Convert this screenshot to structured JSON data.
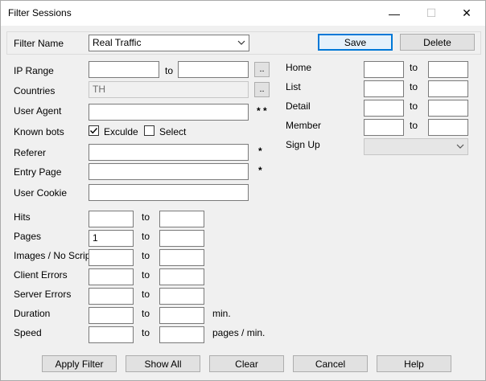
{
  "window": {
    "title": "Filter Sessions",
    "minimize_label": "—",
    "maximize_label": "☐",
    "close_label": "✕"
  },
  "filter": {
    "name_label": "Filter Name",
    "name_value": "Real Traffic",
    "save_label": "Save",
    "delete_label": "Delete"
  },
  "left": {
    "ip_range_label": "IP Range",
    "ip_from": "",
    "ip_to_label": "to",
    "ip_to": "",
    "browse_label": "..",
    "countries_label": "Countries",
    "countries_value": "TH",
    "user_agent_label": "User Agent",
    "user_agent_value": "",
    "user_agent_marker": "* *",
    "known_bots_label": "Known bots",
    "exclude_label": "Exculde",
    "exclude_checked": true,
    "select_label": "Select",
    "select_checked": false,
    "referer_label": "Referer",
    "referer_value": "",
    "referer_marker": "*",
    "entry_page_label": "Entry Page",
    "entry_page_value": "",
    "entry_page_marker": "*",
    "user_cookie_label": "User Cookie",
    "user_cookie_value": ""
  },
  "ranges": {
    "to_label": "to",
    "rows": [
      {
        "label": "Hits",
        "from": "",
        "to": "",
        "suffix": ""
      },
      {
        "label": "Pages",
        "from": "1",
        "to": "",
        "suffix": ""
      },
      {
        "label": "Images / No Script",
        "from": "",
        "to": "",
        "suffix": ""
      },
      {
        "label": "Client Errors",
        "from": "",
        "to": "",
        "suffix": ""
      },
      {
        "label": "Server Errors",
        "from": "",
        "to": "",
        "suffix": ""
      },
      {
        "label": "Duration",
        "from": "",
        "to": "",
        "suffix": "min."
      },
      {
        "label": "Speed",
        "from": "",
        "to": "",
        "suffix": "pages / min."
      }
    ]
  },
  "right": {
    "to_label": "to",
    "rows": [
      {
        "label": "Home",
        "from": "",
        "to": ""
      },
      {
        "label": "List",
        "from": "",
        "to": ""
      },
      {
        "label": "Detail",
        "from": "",
        "to": ""
      },
      {
        "label": "Member",
        "from": "",
        "to": ""
      }
    ],
    "signup_label": "Sign Up",
    "signup_value": ""
  },
  "footer": {
    "apply_label": "Apply Filter",
    "show_all_label": "Show All",
    "clear_label": "Clear",
    "cancel_label": "Cancel",
    "help_label": "Help"
  }
}
